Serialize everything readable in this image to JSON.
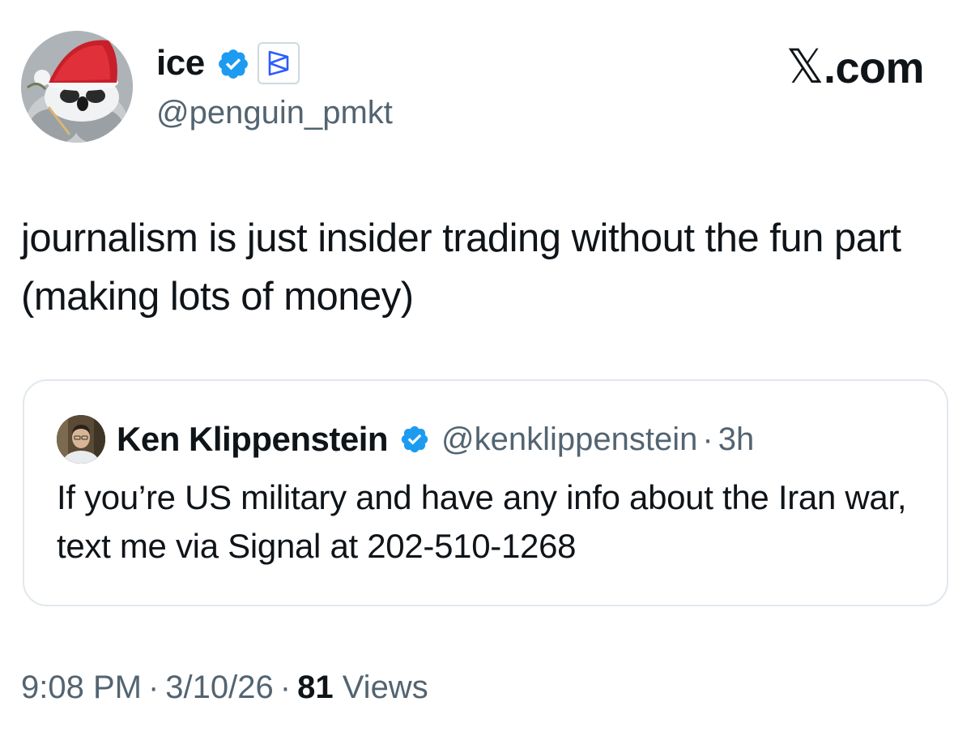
{
  "author": {
    "display_name": "ice",
    "handle": "@penguin_pmkt",
    "avatar_icon": "penguin-santa-hat-avatar",
    "verified_icon": "verified-badge-icon",
    "affiliate_icon": "polymarket-affiliate-icon"
  },
  "brand": {
    "x_glyph": "𝕏",
    "domain": ".com"
  },
  "tweet": {
    "text": "journalism is just insider trading without the fun part (making lots of money)"
  },
  "quote": {
    "author_name": "Ken Klippenstein",
    "handle": "@kenklippenstein",
    "separator": "·",
    "time": "3h",
    "text": "If you’re US military and have any info about the Iran war, text me via Signal at 202-510-1268",
    "avatar_icon": "profile-photo-avatar",
    "verified_icon": "verified-badge-icon"
  },
  "footer": {
    "time": "9:08 PM",
    "date": "3/10/26",
    "views_count": "81",
    "views_label": "Views",
    "separator": "·"
  },
  "colors": {
    "verified_blue": "#1d9bf0",
    "secondary_text": "#536471",
    "primary_text": "#0f1419",
    "card_border": "#e1e8ed",
    "affiliate_blue": "#2e5cff"
  }
}
